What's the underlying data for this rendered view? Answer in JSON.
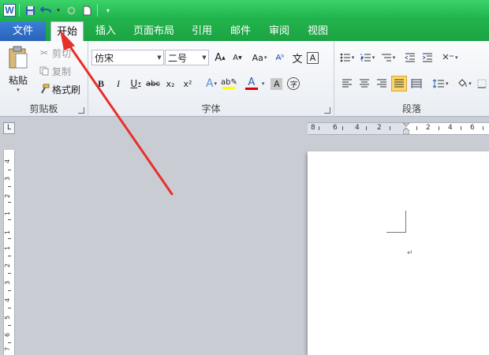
{
  "app": {
    "logo_letter": "W"
  },
  "quick_access": {
    "icons": [
      "save-icon",
      "undo-icon",
      "redo-icon",
      "new-document-icon",
      "customize-icon"
    ]
  },
  "tabs": {
    "file": "文件",
    "items": [
      "开始",
      "插入",
      "页面布局",
      "引用",
      "邮件",
      "审阅",
      "视图"
    ],
    "active_index": 0
  },
  "clipboard": {
    "paste": "粘贴",
    "cut": "剪切",
    "copy": "复制",
    "format_painter": "格式刷",
    "label": "剪贴板"
  },
  "font": {
    "name": "仿宋",
    "size": "二号",
    "label": "字体",
    "grow": "A",
    "shrink": "A",
    "case": "Aa",
    "bold": "B",
    "italic": "I",
    "underline": "U",
    "strike": "abc",
    "subscript": "x₂",
    "superscript": "x²",
    "font_color": "A",
    "highlight_color": "#ffff00",
    "font_color_value": "#e00000",
    "char_shading": "A",
    "enclose": "字",
    "phonetic": "文",
    "border": "A"
  },
  "paragraph": {
    "label": "段落"
  },
  "ruler": {
    "h_numbers": [
      "8",
      "6",
      "4",
      "2",
      "2",
      "4",
      "6"
    ],
    "v_numbers": [
      "4",
      "3",
      "2",
      "1",
      "1",
      "1",
      "2",
      "3",
      "4",
      "5",
      "6",
      "7"
    ],
    "corner": "L"
  },
  "colors": {
    "title_bar": "#1db04a",
    "file_tab": "#2a62b9",
    "arrow": "#e8302a"
  }
}
